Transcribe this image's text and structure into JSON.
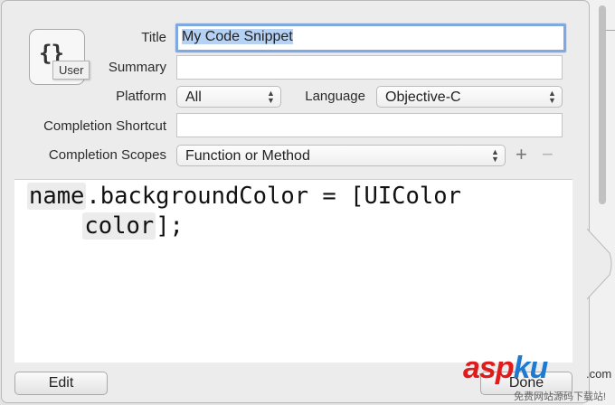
{
  "form": {
    "title_label": "Title",
    "title_value": "My Code Snippet",
    "summary_label": "Summary",
    "summary_value": "",
    "platform_label": "Platform",
    "platform_value": "All",
    "language_label": "Language",
    "language_value": "Objective-C",
    "shortcut_label": "Completion Shortcut",
    "shortcut_value": "",
    "scopes_label": "Completion Scopes",
    "scopes_value": "Function or Method",
    "add_symbol": "+",
    "remove_symbol": "−"
  },
  "icon": {
    "braces": "{}",
    "badge": "User"
  },
  "code": {
    "token1": "name",
    "text1": ".backgroundColor = [UIColor",
    "indent": "    ",
    "token2": "color",
    "text2": "];"
  },
  "buttons": {
    "edit": "Edit",
    "done": "Done"
  },
  "watermark": {
    "brand_red": "asp",
    "brand_blue": "ku",
    "domain": ".com",
    "tagline": "免费网站源码下载站!"
  },
  "colors": {
    "focus_ring": "#7fa9e0",
    "selection": "#b5d2f5",
    "watermark_red": "#e01b1b",
    "watermark_blue": "#1e7ad0"
  }
}
